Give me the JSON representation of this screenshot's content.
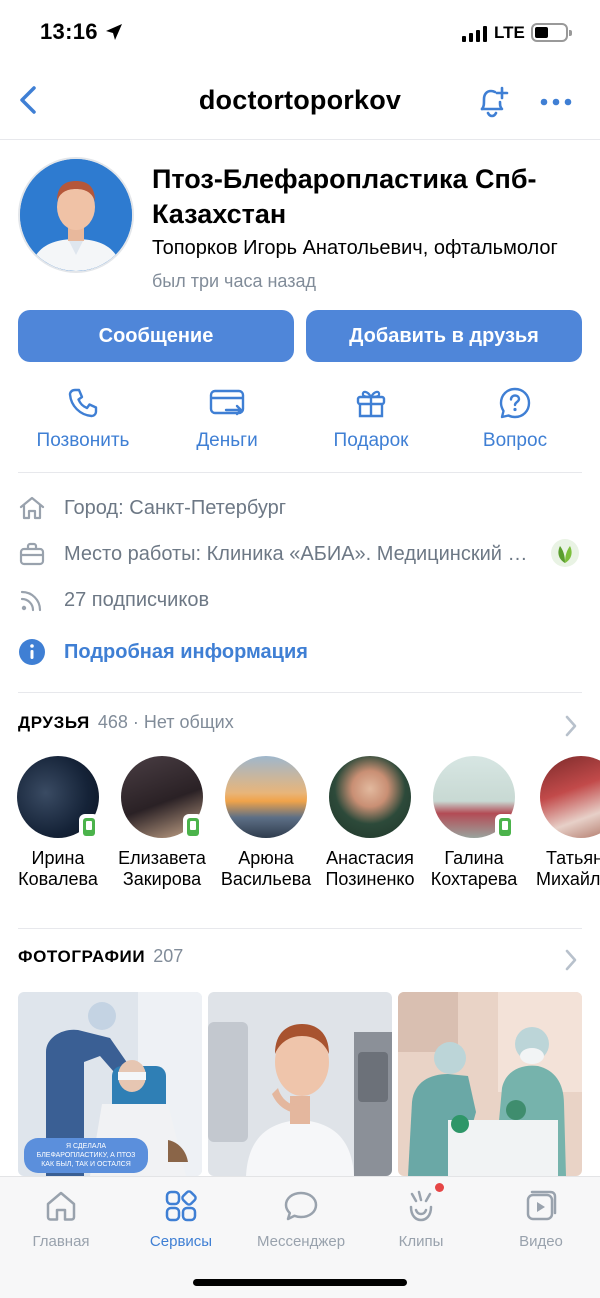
{
  "status_bar": {
    "time": "13:16",
    "network": "LTE"
  },
  "nav": {
    "title": "doctortoporkov"
  },
  "profile": {
    "name": "Птоз-Блефаропластика Спб-Казахстан",
    "status": "Топорков Игорь Анатольевич, офтальмолог",
    "last_seen": "был три часа назад"
  },
  "buttons": {
    "message": "Сообщение",
    "add_friend": "Добавить в друзья"
  },
  "actions": [
    {
      "label": "Позвонить",
      "icon": "phone-icon"
    },
    {
      "label": "Деньги",
      "icon": "money-card-icon"
    },
    {
      "label": "Подарок",
      "icon": "gift-icon"
    },
    {
      "label": "Вопрос",
      "icon": "question-bubble-icon"
    }
  ],
  "info": {
    "city": "Город: Санкт-Петербург",
    "work": "Место работы: Клиника «АБИА». Медицинский центр",
    "followers": "27 подписчиков",
    "details": "Подробная информация"
  },
  "friends": {
    "title": "ДРУЗЬЯ",
    "count": "468 · Нет общих",
    "items": [
      {
        "first": "Ирина",
        "last": "Ковалева",
        "online": true
      },
      {
        "first": "Елизавета",
        "last": "Закирова",
        "online": true
      },
      {
        "first": "Арюна",
        "last": "Васильева",
        "online": false
      },
      {
        "first": "Анастасия",
        "last": "Позиненко",
        "online": false
      },
      {
        "first": "Галина",
        "last": "Кохтарева",
        "online": true
      },
      {
        "first": "Татьяна",
        "last": "Михайлова",
        "online": false
      }
    ]
  },
  "photos": {
    "title": "ФОТОГРАФИИ",
    "count": "207",
    "caption_1": "Я СДЕЛАЛА БЛЕФАРОПЛАСТИКУ, А ПТОЗ КАК БЫЛ, ТАК И ОСТАЛСЯ"
  },
  "tabbar": [
    {
      "label": "Главная",
      "active": false
    },
    {
      "label": "Сервисы",
      "active": true
    },
    {
      "label": "Мессенджер",
      "active": false
    },
    {
      "label": "Клипы",
      "active": false,
      "badge": true
    },
    {
      "label": "Видео",
      "active": false
    }
  ],
  "colors": {
    "accent": "#4f86d9",
    "link": "#3f7fd4",
    "secondary": "#818c99",
    "online": "#4bb34b"
  }
}
